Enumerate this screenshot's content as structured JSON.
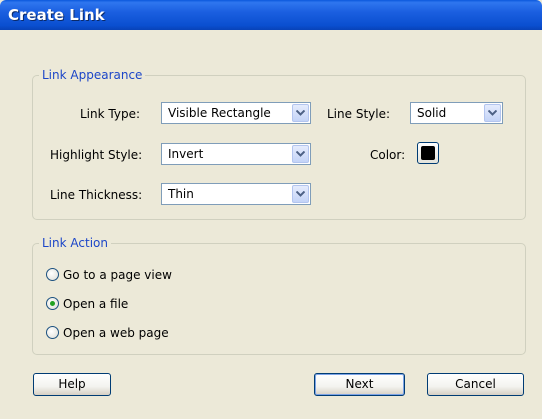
{
  "window": {
    "title": "Create Link"
  },
  "appearance": {
    "legend": "Link Appearance",
    "link_type_label": "Link Type:",
    "link_type_value": "Visible Rectangle",
    "line_style_label": "Line Style:",
    "line_style_value": "Solid",
    "highlight_label": "Highlight Style:",
    "highlight_value": "Invert",
    "color_label": "Color:",
    "color_value": "#000000",
    "thickness_label": "Line Thickness:",
    "thickness_value": "Thin"
  },
  "action": {
    "legend": "Link Action",
    "options": [
      {
        "label": "Go to a page view",
        "selected": false
      },
      {
        "label": "Open a file",
        "selected": true
      },
      {
        "label": "Open a web page",
        "selected": false
      }
    ]
  },
  "buttons": {
    "help": "Help",
    "next": "Next",
    "cancel": "Cancel"
  },
  "icons": {
    "dropdown": "chevron-down-icon",
    "radio_selected_color": "#21a121"
  }
}
